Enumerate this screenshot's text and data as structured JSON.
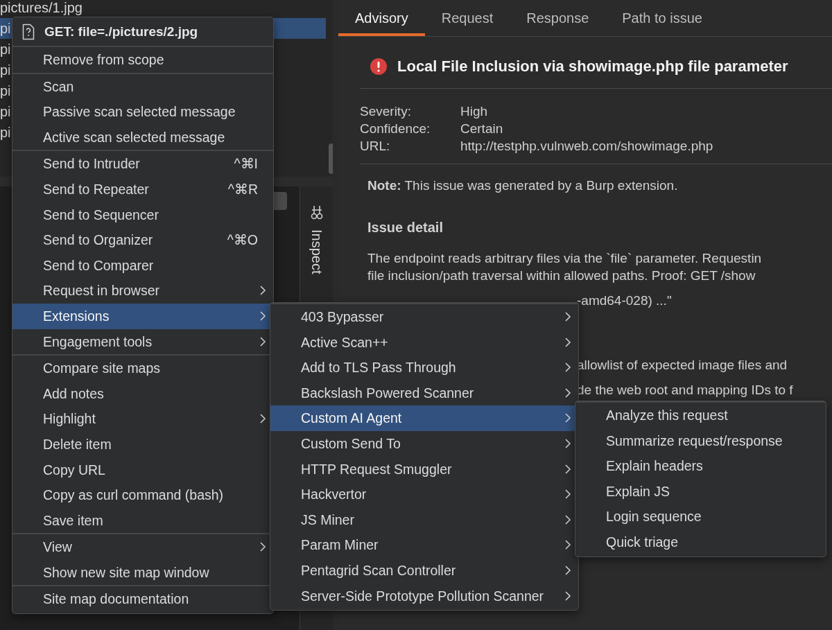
{
  "site_tree": {
    "rows": [
      {
        "label": "pictures/1.jpg",
        "selected": false
      },
      {
        "label": "pi",
        "selected": true
      },
      {
        "label": "pi",
        "selected": false
      },
      {
        "label": "pi",
        "selected": false
      },
      {
        "label": "pi",
        "selected": false
      },
      {
        "label": "pi",
        "selected": false
      },
      {
        "label": "pi",
        "selected": false
      }
    ]
  },
  "side_tab": {
    "label": "Inspect"
  },
  "issue_tabs": [
    {
      "label": "Advisory",
      "selected": true
    },
    {
      "label": "Request",
      "selected": false
    },
    {
      "label": "Response",
      "selected": false
    },
    {
      "label": "Path to issue",
      "selected": false
    }
  ],
  "issue": {
    "title": "Local File Inclusion via showimage.php file parameter",
    "fields": [
      {
        "label": "Severity:",
        "value": "High"
      },
      {
        "label": "Confidence:",
        "value": "Certain"
      },
      {
        "label": "URL:",
        "value": "http://testphp.vulnweb.com/showimage.php"
      }
    ],
    "note": "**Note:** This issue was generated by a Burp extension.",
    "detail_heading": "Issue detail",
    "lines": [
      {
        "text": "The endpoint reads arbitrary files via the `file` parameter. Requestin",
        "kind": "full"
      },
      {
        "text": "file inclusion/path traversal within allowed paths. Proof: GET /show",
        "kind": "full"
      },
      {
        "text": "-amd64-028) ...\"",
        "kind": "covered"
      },
      {
        "text": "allowlist of expected image files and",
        "kind": "covered",
        "gap": true
      },
      {
        "text": "de the web root and mapping IDs to f",
        "kind": "covered"
      }
    ]
  },
  "context_menu": {
    "header": "GET: file=./pictures/2.jpg",
    "groups": [
      [
        {
          "label": "Remove from scope",
          "submenu": false,
          "selected": false
        }
      ],
      [
        {
          "label": "Scan",
          "submenu": false,
          "selected": false
        },
        {
          "label": "Passive scan selected message",
          "submenu": false,
          "selected": false
        },
        {
          "label": "Active scan selected message",
          "submenu": false,
          "selected": false
        }
      ],
      [
        {
          "label": "Send to Intruder",
          "shortcut": "^⌘I",
          "submenu": false,
          "selected": false
        },
        {
          "label": "Send to Repeater",
          "shortcut": "^⌘R",
          "submenu": false,
          "selected": false
        },
        {
          "label": "Send to Sequencer",
          "submenu": false,
          "selected": false
        },
        {
          "label": "Send to Organizer",
          "shortcut": "^⌘O",
          "submenu": false,
          "selected": false
        },
        {
          "label": "Send to Comparer",
          "submenu": false,
          "selected": false
        },
        {
          "label": "Request in browser",
          "submenu": true,
          "selected": false
        },
        {
          "label": "Extensions",
          "submenu": true,
          "selected": true
        },
        {
          "label": "Engagement tools",
          "submenu": true,
          "selected": false
        }
      ],
      [
        {
          "label": "Compare site maps",
          "submenu": false,
          "selected": false
        },
        {
          "label": "Add notes",
          "submenu": false,
          "selected": false
        },
        {
          "label": "Highlight",
          "submenu": true,
          "selected": false
        },
        {
          "label": "Delete item",
          "submenu": false,
          "selected": false
        },
        {
          "label": "Copy URL",
          "submenu": false,
          "selected": false
        },
        {
          "label": "Copy as curl command (bash)",
          "submenu": false,
          "selected": false
        },
        {
          "label": "Save item",
          "submenu": false,
          "selected": false
        }
      ],
      [
        {
          "label": "View",
          "submenu": true,
          "selected": false
        },
        {
          "label": "Show new site map window",
          "submenu": false,
          "selected": false
        }
      ],
      [
        {
          "label": "Site map documentation",
          "submenu": false,
          "selected": false
        }
      ]
    ]
  },
  "extensions_menu": {
    "items": [
      {
        "label": "403 Bypasser",
        "submenu": true,
        "selected": false
      },
      {
        "label": "Active Scan++",
        "submenu": true,
        "selected": false
      },
      {
        "label": "Add to TLS Pass Through",
        "submenu": true,
        "selected": false
      },
      {
        "label": "Backslash Powered Scanner",
        "submenu": true,
        "selected": false
      },
      {
        "label": "Custom AI Agent",
        "submenu": true,
        "selected": true
      },
      {
        "label": "Custom Send To",
        "submenu": true,
        "selected": false
      },
      {
        "label": "HTTP Request Smuggler",
        "submenu": true,
        "selected": false
      },
      {
        "label": "Hackvertor",
        "submenu": true,
        "selected": false
      },
      {
        "label": "JS Miner",
        "submenu": true,
        "selected": false
      },
      {
        "label": "Param Miner",
        "submenu": true,
        "selected": false
      },
      {
        "label": "Pentagrid Scan Controller",
        "submenu": true,
        "selected": false
      },
      {
        "label": "Server-Side Prototype Pollution Scanner",
        "submenu": true,
        "selected": false
      }
    ]
  },
  "agent_menu": {
    "items": [
      {
        "label": "Analyze this request",
        "submenu": false,
        "selected": false
      },
      {
        "label": "Summarize request/response",
        "submenu": false,
        "selected": false
      },
      {
        "label": "Explain headers",
        "submenu": false,
        "selected": false
      },
      {
        "label": "Explain JS",
        "submenu": false,
        "selected": false
      },
      {
        "label": "Login sequence",
        "submenu": false,
        "selected": false
      },
      {
        "label": "Quick triage",
        "submenu": false,
        "selected": false
      }
    ]
  }
}
